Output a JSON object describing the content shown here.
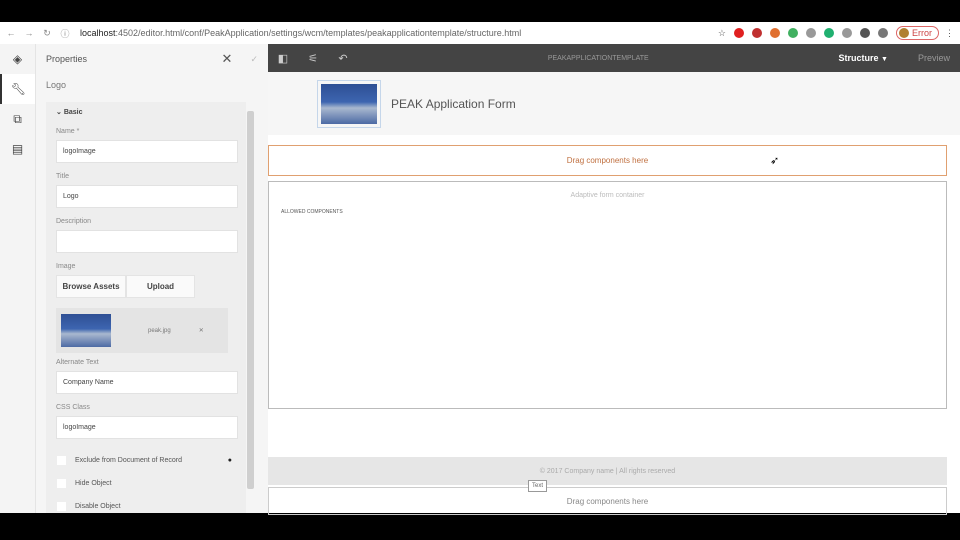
{
  "browser": {
    "url_host": "localhost",
    "url_rest": ":4502/editor.html/conf/PeakApplication/settings/wcm/templates/peakapplicationtemplate/structure.html",
    "profile_label": "Error",
    "extension_colors": [
      "#e02020",
      "#c03030",
      "#e07030",
      "#40b060",
      "#999",
      "#20b070",
      "#999",
      "#555",
      "#777"
    ]
  },
  "panel": {
    "title": "Properties",
    "breadcrumb": "Logo",
    "section": "Basic",
    "name_label": "Name *",
    "name_value": "logoImage",
    "title_label": "Title",
    "title_value": "Logo",
    "description_label": "Description",
    "description_value": "",
    "image_label": "Image",
    "browse_label": "Browse Assets",
    "upload_label": "Upload",
    "file_name": "peak.jpg",
    "alt_label": "Alternate Text",
    "alt_value": "Company Name",
    "css_label": "CSS Class",
    "css_value": "logoImage",
    "checkboxes": [
      "Exclude from Document of Record",
      "Hide Object",
      "Disable Object"
    ]
  },
  "toolbar": {
    "template_title": "PEAKAPPLICATIONTEMPLATE",
    "mode": "Structure",
    "preview": "Preview"
  },
  "canvas": {
    "form_title": "PEAK Application Form",
    "drag_here": "Drag components here",
    "container_label": "Adaptive form container",
    "allowed_components": "ALLOWED COMPONENTS",
    "footer": "© 2017 Company name | All rights reserved",
    "tooltip": "Text",
    "drag_here_2": "Drag components here"
  }
}
